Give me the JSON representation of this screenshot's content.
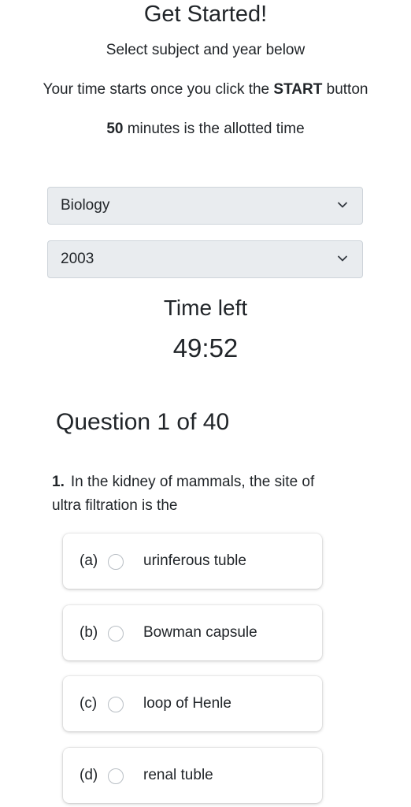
{
  "header": {
    "title": "Get Started!",
    "subtitle": "Select subject and year below"
  },
  "info": {
    "line1_prefix": "Your time starts once you click the ",
    "line1_bold": "START",
    "line1_suffix": " button",
    "line2_bold": "50",
    "line2_suffix": " minutes is the allotted time"
  },
  "selects": {
    "subject": "Biology",
    "year": "2003"
  },
  "timer": {
    "label": "Time left",
    "value": "49:52"
  },
  "question": {
    "heading": "Question 1 of 40",
    "number": "1.",
    "text": "In the kidney of mammals, the site of ultra filtration is the",
    "options": [
      {
        "letter": "(a)",
        "text": "urinferous tuble"
      },
      {
        "letter": "(b)",
        "text": "Bowman capsule"
      },
      {
        "letter": "(c)",
        "text": "loop of Henle"
      },
      {
        "letter": "(d)",
        "text": "renal tuble"
      }
    ]
  },
  "icons": {
    "select_chevron": "chevron-down-icon",
    "option_radio": "radio-unchecked-icon"
  }
}
